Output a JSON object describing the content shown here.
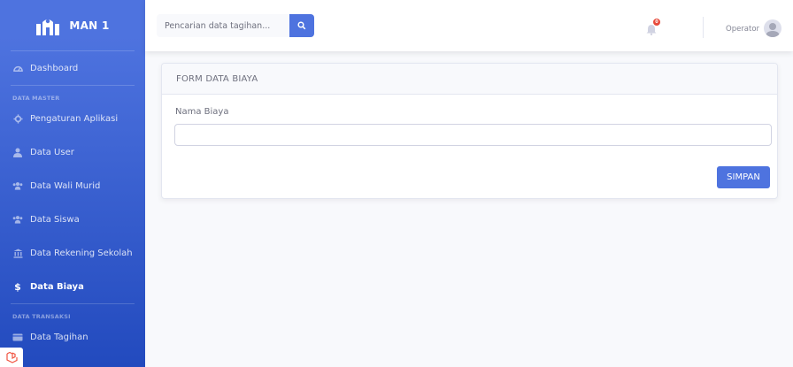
{
  "brand": {
    "name": "MAN 1"
  },
  "sidebar": {
    "dashboard": "Dashboard",
    "heading_master": "DATA MASTER",
    "items": [
      {
        "label": "Pengaturan Aplikasi",
        "icon": "cog-icon"
      },
      {
        "label": "Data User",
        "icon": "user-icon"
      },
      {
        "label": "Data Wali Murid",
        "icon": "users-icon"
      },
      {
        "label": "Data Siswa",
        "icon": "users-icon"
      },
      {
        "label": "Data Rekening Sekolah",
        "icon": "university-icon"
      },
      {
        "label": "Data Biaya",
        "icon": "dollar-icon",
        "active": true
      }
    ],
    "heading_transaksi": "DATA TRANSAKSI",
    "transaksi_items": [
      {
        "label": "Data Tagihan",
        "icon": "invoice-icon"
      }
    ],
    "dollar_glyph": "$"
  },
  "topbar": {
    "search_placeholder": "Pencarian data tagihan...",
    "notification_count": "0",
    "user_name": "Operator"
  },
  "card": {
    "title": "FORM DATA BIAYA",
    "field_label": "Nama Biaya",
    "field_value": "",
    "save_label": "SIMPAN"
  },
  "colors": {
    "primary": "#4e73df",
    "sidebar_gradient_end": "#224abe",
    "danger": "#e74a3b",
    "background": "#f8f9fc"
  }
}
